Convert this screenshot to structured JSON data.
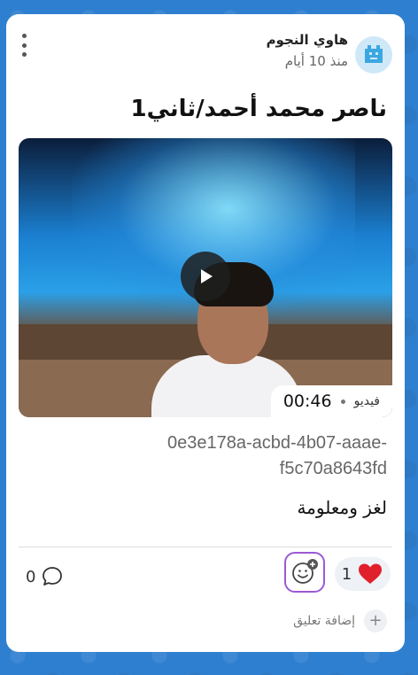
{
  "post": {
    "author_name": "هاوي النجوم",
    "time_ago": "منذ 10 أيام",
    "title": "ناصر محمد أحمد/ثاني1",
    "video": {
      "type_label": "فيديو",
      "duration": "00:46"
    },
    "caption_id": "0e3e178a-acbd-4b07-aaae-f5c70a8643fd",
    "body": "لغز ومعلومة"
  },
  "footer": {
    "comments_count": "0",
    "likes_count": "1",
    "add_comment_label": "إضافة تعليق"
  },
  "colors": {
    "background": "#2f7fd0",
    "reaction_border": "#9b59d6",
    "heart": "#e0202a"
  }
}
